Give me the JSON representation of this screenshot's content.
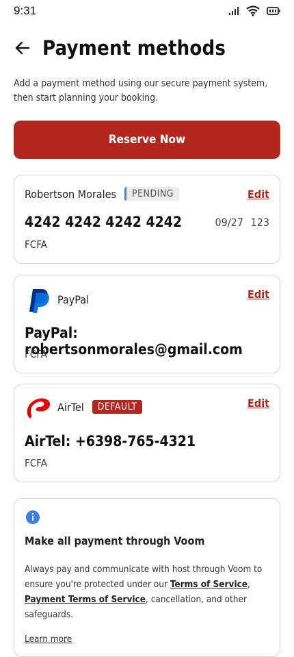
{
  "status_bar": {
    "time": "9:31"
  },
  "header": {
    "title": "Payment methods"
  },
  "intro": {
    "text": "Add a payment method using our secure payment system, then start planning your booking."
  },
  "reserve_button": {
    "label": "Reserve Now"
  },
  "cards": {
    "card": {
      "holder": "Robertson Morales",
      "status": "PENDING",
      "edit": "Edit",
      "number": "4242 4242 4242 4242",
      "expiry": "09/27",
      "cvv": "123",
      "currency": "FCFA"
    },
    "paypal": {
      "name": "PayPal",
      "edit": "Edit",
      "detail": "PayPal: robertsonmorales@gmail.com",
      "currency": "FCFA"
    },
    "airtel": {
      "name": "AirTel",
      "badge": "DEFAULT",
      "edit": "Edit",
      "detail": "AirTel: +6398-765-4321",
      "currency": "FCFA"
    }
  },
  "info": {
    "title": "Make all payment through Voom",
    "text_before": "Always pay and communicate with host through Voom to ensure you're protected under our ",
    "link1": "Terms of Service",
    "comma": ", ",
    "link2": "Payment Terms of Service",
    "text_after": ", cancellation, and other safeguards.",
    "learn_more": "Learn more"
  },
  "colors": {
    "accent": "#b3261e",
    "info_icon": "#3d7de8"
  }
}
